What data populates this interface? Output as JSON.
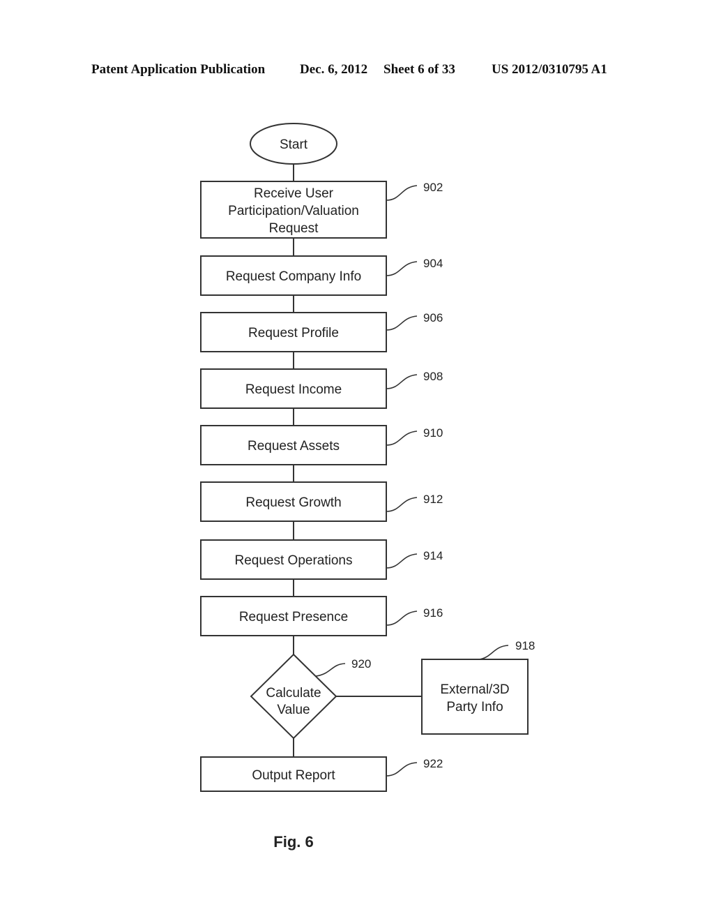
{
  "header": {
    "publication": "Patent Application Publication",
    "date": "Dec. 6, 2012",
    "sheet": "Sheet 6 of 33",
    "number": "US 2012/0310795 A1"
  },
  "flowchart": {
    "start": {
      "label": "Start"
    },
    "steps": [
      {
        "ref": "902",
        "lines": [
          "Receive User",
          "Participation/Valuation",
          "Request"
        ]
      },
      {
        "ref": "904",
        "lines": [
          "Request Company Info"
        ]
      },
      {
        "ref": "906",
        "lines": [
          "Request Profile"
        ]
      },
      {
        "ref": "908",
        "lines": [
          "Request Income"
        ]
      },
      {
        "ref": "910",
        "lines": [
          "Request Assets"
        ]
      },
      {
        "ref": "912",
        "lines": [
          "Request Growth"
        ]
      },
      {
        "ref": "914",
        "lines": [
          "Request Operations"
        ]
      },
      {
        "ref": "916",
        "lines": [
          "Request Presence"
        ]
      }
    ],
    "decision": {
      "ref": "920",
      "lines": [
        "Calculate",
        "Value"
      ]
    },
    "external": {
      "ref": "918",
      "lines": [
        "External/3D",
        "Party Info"
      ]
    },
    "output": {
      "ref": "922",
      "lines": [
        "Output Report"
      ]
    }
  },
  "figure_label": "Fig. 6"
}
